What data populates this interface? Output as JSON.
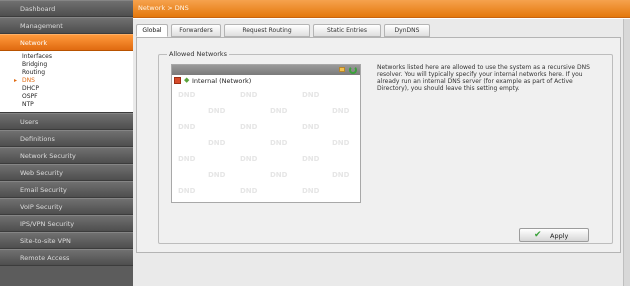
{
  "header": {
    "breadcrumb": "Network > DNS"
  },
  "sidebar": {
    "items_top": [
      {
        "label": "Dashboard"
      },
      {
        "label": "Management"
      },
      {
        "label": "Network",
        "active": true
      }
    ],
    "submenu": [
      {
        "label": "Interfaces"
      },
      {
        "label": "Bridging"
      },
      {
        "label": "Routing"
      },
      {
        "label": "DNS",
        "active": true
      },
      {
        "label": "DHCP"
      },
      {
        "label": "OSPF"
      },
      {
        "label": "NTP"
      }
    ],
    "items_bottom": [
      {
        "label": "Users"
      },
      {
        "label": "Definitions"
      },
      {
        "label": "Network Security"
      },
      {
        "label": "Web Security"
      },
      {
        "label": "Email Security"
      },
      {
        "label": "VoIP Security"
      },
      {
        "label": "IPS/VPN Security"
      },
      {
        "label": "Site-to-site VPN"
      },
      {
        "label": "Remote Access"
      }
    ]
  },
  "tabs": [
    {
      "label": "Global",
      "active": true
    },
    {
      "label": "Forwarders"
    },
    {
      "label": "Request Routing"
    },
    {
      "label": "Static Entries"
    },
    {
      "label": "DynDNS"
    }
  ],
  "allowed_networks": {
    "legend": "Allowed Networks",
    "entries": [
      {
        "label": "Internal (Network)"
      }
    ],
    "watermark": "DND",
    "help": "Networks listed here are allowed to use the system as a recursive DNS resolver. You will typically specify your internal networks here. If you already run an internal DNS server (for example as part of Active Directory), you should leave this setting empty."
  },
  "apply": {
    "label": "Apply"
  },
  "icons": {
    "add": "folder-add-icon",
    "refresh": "refresh-icon",
    "remove": "remove-icon",
    "network": "network-icon",
    "apply": "checkmark-icon"
  },
  "colors": {
    "accent": "#e8780c",
    "sidebar": "#5c5c5c",
    "active_link": "#e06a10"
  }
}
